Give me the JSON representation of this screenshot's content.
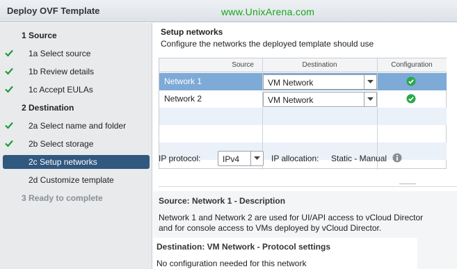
{
  "window": {
    "title": "Deploy OVF Template",
    "watermark": "www.UnixArena.com"
  },
  "sidebar": {
    "steps": [
      {
        "label": "1  Source",
        "state": "section"
      },
      {
        "label": "1a  Select source",
        "state": "done"
      },
      {
        "label": "1b  Review details",
        "state": "done"
      },
      {
        "label": "1c  Accept EULAs",
        "state": "done"
      },
      {
        "label": "2  Destination",
        "state": "section"
      },
      {
        "label": "2a  Select name and folder",
        "state": "done"
      },
      {
        "label": "2b  Select storage",
        "state": "done"
      },
      {
        "label": "2c  Setup networks",
        "state": "active-done"
      },
      {
        "label": "2d  Customize template",
        "state": "pending"
      },
      {
        "label": "3  Ready to complete",
        "state": "disabled"
      }
    ]
  },
  "main": {
    "heading": "Setup networks",
    "subheading": "Configure the networks the deployed template should use",
    "table": {
      "columns": [
        "Source",
        "Destination",
        "Configuration"
      ],
      "rows": [
        {
          "source": "Network 1",
          "destination": "VM Network",
          "configuration": "ok",
          "selected": true
        },
        {
          "source": "Network 2",
          "destination": "VM Network",
          "configuration": "ok",
          "selected": false
        }
      ]
    },
    "ip": {
      "protocol_label": "IP protocol:",
      "protocol_value": "IPv4",
      "allocation_label": "IP allocation:",
      "allocation_value": "Static - Manual"
    },
    "description": {
      "source_title": "Source: Network 1 - Description",
      "source_line1": "Network 1 and Network 2 are used for UI/API access to vCloud Director",
      "source_line2": "and for console access to VMs deployed by vCloud Director.",
      "destination_title": "Destination: VM Network - Protocol settings",
      "destination_text": "No configuration needed for this network"
    }
  },
  "colors": {
    "accent_active": "#31587f",
    "selected_row": "#7daad6",
    "check_green": "#1e9a3a",
    "watermark_green": "#1aa51a"
  }
}
